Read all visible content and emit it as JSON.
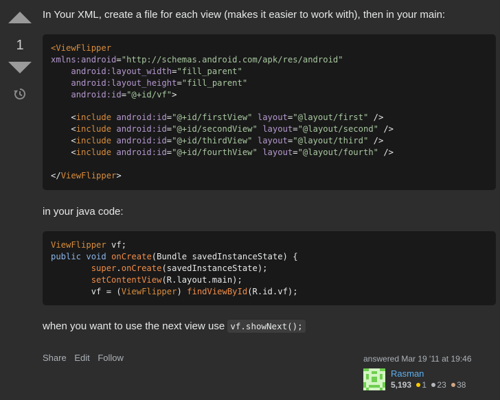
{
  "votes": {
    "count": "1"
  },
  "post": {
    "intro": "In Your XML, create a file for each view (makes it easier to work with), then in your main:",
    "java_intro": "in your java code:",
    "next_view_text": "when you want to use the next view use",
    "next_view_code": "vf.showNext();"
  },
  "code_xml": [
    [
      [
        "tag",
        "<ViewFlipper"
      ]
    ],
    [
      [
        "attr",
        "xmlns:android"
      ],
      [
        "plain",
        "="
      ],
      [
        "str",
        "\"http://schemas.android.com/apk/res/android\""
      ]
    ],
    [
      [
        "plain",
        "    "
      ],
      [
        "attr",
        "android:layout_width"
      ],
      [
        "plain",
        "="
      ],
      [
        "str",
        "\"fill_parent\""
      ]
    ],
    [
      [
        "plain",
        "    "
      ],
      [
        "attr",
        "android:layout_height"
      ],
      [
        "plain",
        "="
      ],
      [
        "str",
        "\"fill_parent\""
      ]
    ],
    [
      [
        "plain",
        "    "
      ],
      [
        "attr",
        "android:id"
      ],
      [
        "plain",
        "="
      ],
      [
        "str",
        "\"@+id/vf\""
      ],
      [
        "plain",
        ">"
      ]
    ],
    [
      [
        "plain",
        ""
      ]
    ],
    [
      [
        "plain",
        "    <"
      ],
      [
        "tag",
        "include"
      ],
      [
        "plain",
        " "
      ],
      [
        "attr",
        "android:id"
      ],
      [
        "plain",
        "="
      ],
      [
        "str",
        "\"@+id/firstView\""
      ],
      [
        "plain",
        " "
      ],
      [
        "attr",
        "layout"
      ],
      [
        "plain",
        "="
      ],
      [
        "str",
        "\"@layout/first\""
      ],
      [
        "plain",
        " />"
      ]
    ],
    [
      [
        "plain",
        "    <"
      ],
      [
        "tag",
        "include"
      ],
      [
        "plain",
        " "
      ],
      [
        "attr",
        "android:id"
      ],
      [
        "plain",
        "="
      ],
      [
        "str",
        "\"@+id/secondView\""
      ],
      [
        "plain",
        " "
      ],
      [
        "attr",
        "layout"
      ],
      [
        "plain",
        "="
      ],
      [
        "str",
        "\"@layout/second\""
      ],
      [
        "plain",
        " />"
      ]
    ],
    [
      [
        "plain",
        "    <"
      ],
      [
        "tag",
        "include"
      ],
      [
        "plain",
        " "
      ],
      [
        "attr",
        "android:id"
      ],
      [
        "plain",
        "="
      ],
      [
        "str",
        "\"@+id/thirdView\""
      ],
      [
        "plain",
        " "
      ],
      [
        "attr",
        "layout"
      ],
      [
        "plain",
        "="
      ],
      [
        "str",
        "\"@layout/third\""
      ],
      [
        "plain",
        " />"
      ]
    ],
    [
      [
        "plain",
        "    <"
      ],
      [
        "tag",
        "include"
      ],
      [
        "plain",
        " "
      ],
      [
        "attr",
        "android:id"
      ],
      [
        "plain",
        "="
      ],
      [
        "str",
        "\"@+id/fourthView\""
      ],
      [
        "plain",
        " "
      ],
      [
        "attr",
        "layout"
      ],
      [
        "plain",
        "="
      ],
      [
        "str",
        "\"@layout/fourth\""
      ],
      [
        "plain",
        " />"
      ]
    ],
    [
      [
        "plain",
        ""
      ]
    ],
    [
      [
        "plain",
        "</"
      ],
      [
        "tag",
        "ViewFlipper"
      ],
      [
        "plain",
        ">"
      ]
    ]
  ],
  "code_java": [
    [
      [
        "tag",
        "ViewFlipper"
      ],
      [
        "plain",
        " vf;"
      ]
    ],
    [
      [
        "kw",
        "public"
      ],
      [
        "plain",
        " "
      ],
      [
        "kw",
        "void"
      ],
      [
        "plain",
        " "
      ],
      [
        "fn",
        "onCreate"
      ],
      [
        "plain",
        "(Bundle savedInstanceState) {"
      ]
    ],
    [
      [
        "plain",
        "        "
      ],
      [
        "fn",
        "super"
      ],
      [
        "plain",
        "."
      ],
      [
        "fn",
        "onCreate"
      ],
      [
        "plain",
        "(savedInstanceState);"
      ]
    ],
    [
      [
        "plain",
        "        "
      ],
      [
        "fn",
        "setContentView"
      ],
      [
        "plain",
        "(R.layout.main);"
      ]
    ],
    [
      [
        "plain",
        "        vf = ("
      ],
      [
        "tag",
        "ViewFlipper"
      ],
      [
        "plain",
        ") "
      ],
      [
        "fn",
        "findViewById"
      ],
      [
        "plain",
        "(R.id.vf);"
      ]
    ]
  ],
  "menu": {
    "share": "Share",
    "edit": "Edit",
    "follow": "Follow"
  },
  "signature": {
    "answered": "answered Mar 19 '11 at 19:46",
    "user_name": "Rasman",
    "reputation": "5,193",
    "gold": "1",
    "silver": "23",
    "bronze": "38"
  },
  "icons": {
    "vote_up": "triangle-up-icon",
    "vote_down": "triangle-down-icon",
    "history": "history-icon"
  },
  "colors": {
    "background": "#2d2d2d",
    "code_background": "#191919",
    "link": "#5eb0ef",
    "tag": "#d98d3d",
    "attr": "#b599cf",
    "string": "#a8c7a0",
    "keyword": "#8bb4e7",
    "function": "#f08d49"
  }
}
